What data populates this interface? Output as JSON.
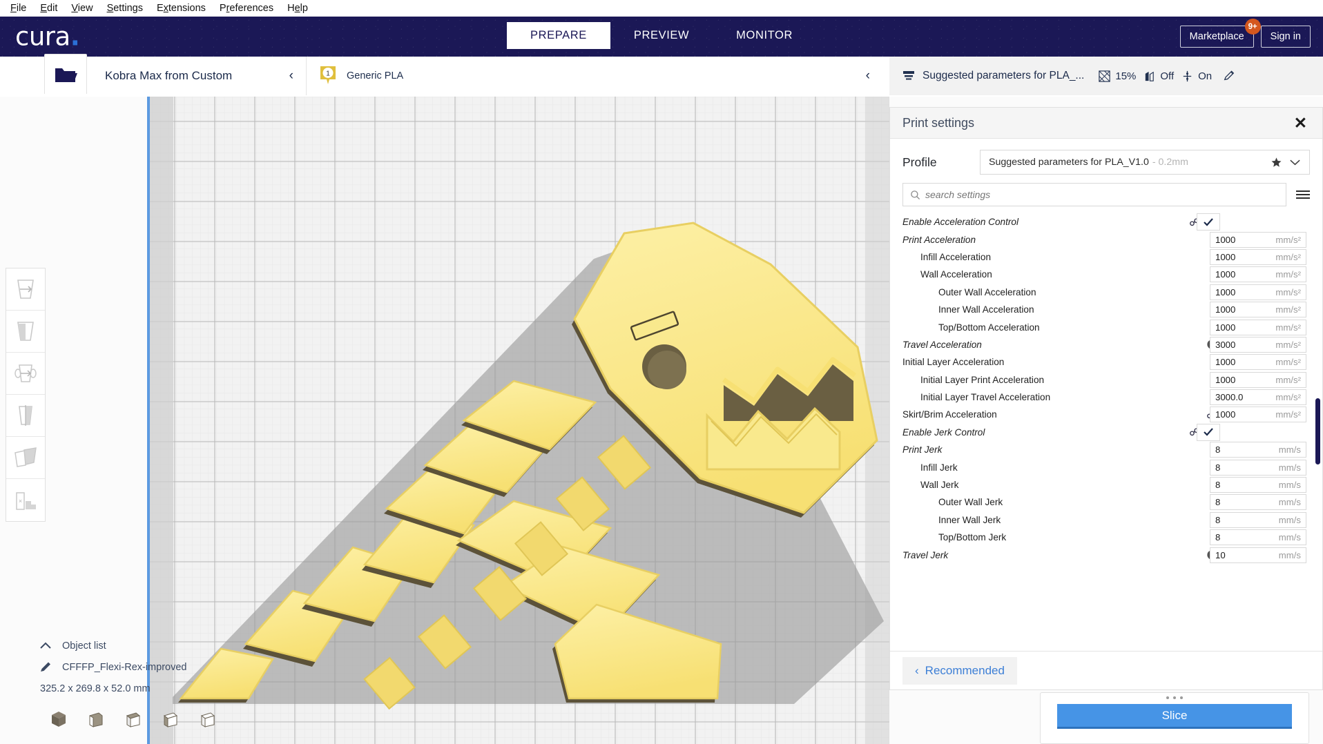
{
  "menubar": {
    "items": [
      {
        "pre": "",
        "key": "F",
        "post": "ile"
      },
      {
        "pre": "",
        "key": "E",
        "post": "dit"
      },
      {
        "pre": "",
        "key": "V",
        "post": "iew"
      },
      {
        "pre": "",
        "key": "S",
        "post": "ettings"
      },
      {
        "pre": "E",
        "key": "x",
        "post": "tensions"
      },
      {
        "pre": "P",
        "key": "r",
        "post": "eferences"
      },
      {
        "pre": "H",
        "key": "e",
        "post": "lp"
      }
    ]
  },
  "header": {
    "logo_text": "cura",
    "logo_dot": ".",
    "tabs": [
      {
        "label": "PREPARE",
        "active": true
      },
      {
        "label": "PREVIEW",
        "active": false
      },
      {
        "label": "MONITOR",
        "active": false
      }
    ],
    "marketplace_label": "Marketplace",
    "marketplace_badge": "9+",
    "signin_label": "Sign in",
    "brand_color": "#1b1856",
    "badge_color": "#d4571e"
  },
  "subbar": {
    "open_file_icon": "folder-open-icon",
    "printer_name": "Kobra Max from Custom",
    "printer_chevron": "‹",
    "extruder_number": "1",
    "material_name": "Generic PLA",
    "material_chevron": "‹"
  },
  "setup_summary": {
    "layer_height_icon": "layer-height-icon",
    "profile_label": "Suggested parameters for PLA_...",
    "infill_icon": "infill-icon",
    "infill_value": "15%",
    "support_icon": "support-icon",
    "support_value": "Off",
    "adhesion_icon": "adhesion-icon",
    "adhesion_value": "On",
    "edit_icon": "pencil-icon"
  },
  "left_tools": [
    {
      "name": "move-tool",
      "label": "Move"
    },
    {
      "name": "scale-tool",
      "label": "Scale"
    },
    {
      "name": "rotate-tool",
      "label": "Rotate"
    },
    {
      "name": "mirror-tool",
      "label": "Mirror"
    },
    {
      "name": "per-model-settings-tool",
      "label": "Per Model Settings"
    },
    {
      "name": "support-blocker-tool",
      "label": "Support Blocker"
    }
  ],
  "object_list": {
    "toggle_icon": "chevron-up-icon",
    "title": "Object list",
    "item_icon": "pencil-icon",
    "item_name": "CFFFP_Flexi-Rex-improved",
    "dimensions": "325.2 x 269.8 x 52.0 mm"
  },
  "view_cubes": [
    {
      "name": "view-3d-icon"
    },
    {
      "name": "view-front-icon"
    },
    {
      "name": "view-top-icon"
    },
    {
      "name": "view-left-icon"
    },
    {
      "name": "view-right-icon"
    }
  ],
  "print_settings": {
    "title": "Print settings",
    "close_icon": "close-icon",
    "profile_label": "Profile",
    "profile_value": "Suggested parameters for PLA_V1.0",
    "profile_sub": "- 0.2mm",
    "star_icon": "star-icon",
    "dropdown_icon": "chevron-down-icon",
    "search_placeholder": "search settings",
    "search_value": "",
    "search_icon": "search-icon",
    "menu_icon": "hamburger-menu-icon",
    "recommended_label": "Recommended",
    "recommended_chevron": "‹",
    "rows": [
      {
        "label": "Enable Acceleration Control",
        "indent": 0,
        "italic": true,
        "type": "checkbox",
        "checked": true,
        "icons": [
          "link-icon",
          "revert-icon"
        ]
      },
      {
        "label": "Print Acceleration",
        "indent": 0,
        "italic": true,
        "value": "1000",
        "unit": "mm/s²",
        "icons": []
      },
      {
        "label": "Infill Acceleration",
        "indent": 1,
        "italic": false,
        "value": "1000",
        "unit": "mm/s²",
        "icons": []
      },
      {
        "label": "Wall Acceleration",
        "indent": 1,
        "italic": false,
        "value": "1000",
        "unit": "mm/s²",
        "icons": []
      },
      {
        "label": "Outer Wall Acceleration",
        "indent": 2,
        "italic": false,
        "value": "1000",
        "unit": "mm/s²",
        "icons": []
      },
      {
        "label": "Inner Wall Acceleration",
        "indent": 2,
        "italic": false,
        "value": "1000",
        "unit": "mm/s²",
        "icons": []
      },
      {
        "label": "Top/Bottom Acceleration",
        "indent": 2,
        "italic": false,
        "value": "1000",
        "unit": "mm/s²",
        "icons": []
      },
      {
        "label": "Travel Acceleration",
        "indent": 0,
        "italic": true,
        "value": "3000",
        "unit": "mm/s²",
        "icons": [
          "function-icon"
        ]
      },
      {
        "label": "Initial Layer Acceleration",
        "indent": 0,
        "italic": false,
        "value": "1000",
        "unit": "mm/s²",
        "icons": []
      },
      {
        "label": "Initial Layer Print Acceleration",
        "indent": 1,
        "italic": false,
        "value": "1000",
        "unit": "mm/s²",
        "icons": []
      },
      {
        "label": "Initial Layer Travel Acceleration",
        "indent": 1,
        "italic": false,
        "value": "3000.0",
        "unit": "mm/s²",
        "icons": []
      },
      {
        "label": "Skirt/Brim Acceleration",
        "indent": 0,
        "italic": false,
        "value": "1000",
        "unit": "mm/s²",
        "icons": [
          "link-icon"
        ]
      },
      {
        "label": "Enable Jerk Control",
        "indent": 0,
        "italic": true,
        "type": "checkbox",
        "checked": true,
        "icons": [
          "link-icon",
          "revert-icon"
        ]
      },
      {
        "label": "Print Jerk",
        "indent": 0,
        "italic": true,
        "value": "8",
        "unit": "mm/s",
        "icons": []
      },
      {
        "label": "Infill Jerk",
        "indent": 1,
        "italic": false,
        "value": "8",
        "unit": "mm/s",
        "icons": []
      },
      {
        "label": "Wall Jerk",
        "indent": 1,
        "italic": false,
        "value": "8",
        "unit": "mm/s",
        "icons": []
      },
      {
        "label": "Outer Wall Jerk",
        "indent": 2,
        "italic": false,
        "value": "8",
        "unit": "mm/s",
        "icons": []
      },
      {
        "label": "Inner Wall Jerk",
        "indent": 2,
        "italic": false,
        "value": "8",
        "unit": "mm/s",
        "icons": []
      },
      {
        "label": "Top/Bottom Jerk",
        "indent": 2,
        "italic": false,
        "value": "8",
        "unit": "mm/s",
        "icons": []
      },
      {
        "label": "Travel Jerk",
        "indent": 0,
        "italic": true,
        "value": "10",
        "unit": "mm/s",
        "icons": [
          "function-icon"
        ]
      }
    ]
  },
  "slice_panel": {
    "slice_label": "Slice",
    "slice_color": "#4694e6",
    "drag_handle": "drag-handle-dots"
  },
  "model": {
    "name": "CFFFP_Flexi-Rex-improved",
    "body_color": "#f9e98d",
    "shade_color": "#5a5038",
    "shadow_color": "#9a9a9a"
  }
}
